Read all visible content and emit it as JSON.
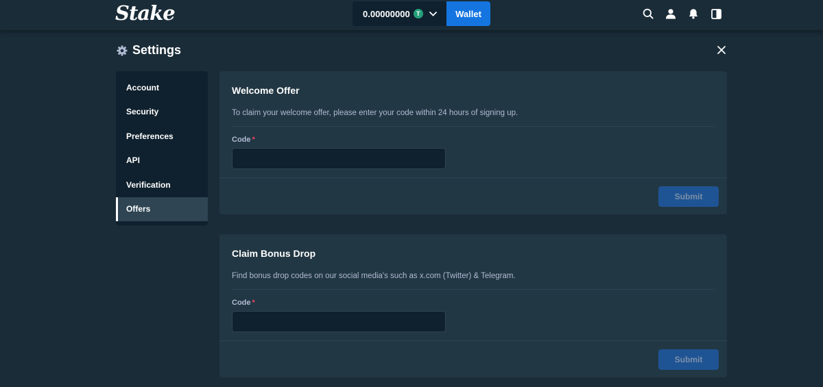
{
  "header": {
    "logo": "Stake",
    "balance": "0.00000000",
    "currency_symbol": "T",
    "wallet_label": "Wallet",
    "icons": [
      "search-icon",
      "user-icon",
      "bell-icon",
      "sidebar-toggle-icon"
    ]
  },
  "page": {
    "title": "Settings"
  },
  "sidebar": {
    "items": [
      {
        "label": "Account"
      },
      {
        "label": "Security"
      },
      {
        "label": "Preferences"
      },
      {
        "label": "API"
      },
      {
        "label": "Verification"
      },
      {
        "label": "Offers",
        "active": true
      }
    ]
  },
  "welcome_offer": {
    "title": "Welcome Offer",
    "description": "To claim your welcome offer, please enter your code within 24 hours of signing up.",
    "field_label": "Code",
    "required_mark": "*",
    "value": "",
    "submit_label": "Submit"
  },
  "bonus_drop": {
    "title": "Claim Bonus Drop",
    "description": "Find bonus drop codes on our social media's such as x.com (Twitter) & Telegram.",
    "field_label": "Code",
    "required_mark": "*",
    "value": "",
    "submit_label": "Submit"
  },
  "colors": {
    "background": "#1a2c38",
    "panel": "#213743",
    "input": "#0f212e",
    "accent": "#1475e1",
    "submit_disabled": "#1f5494",
    "required": "#ed4163"
  }
}
